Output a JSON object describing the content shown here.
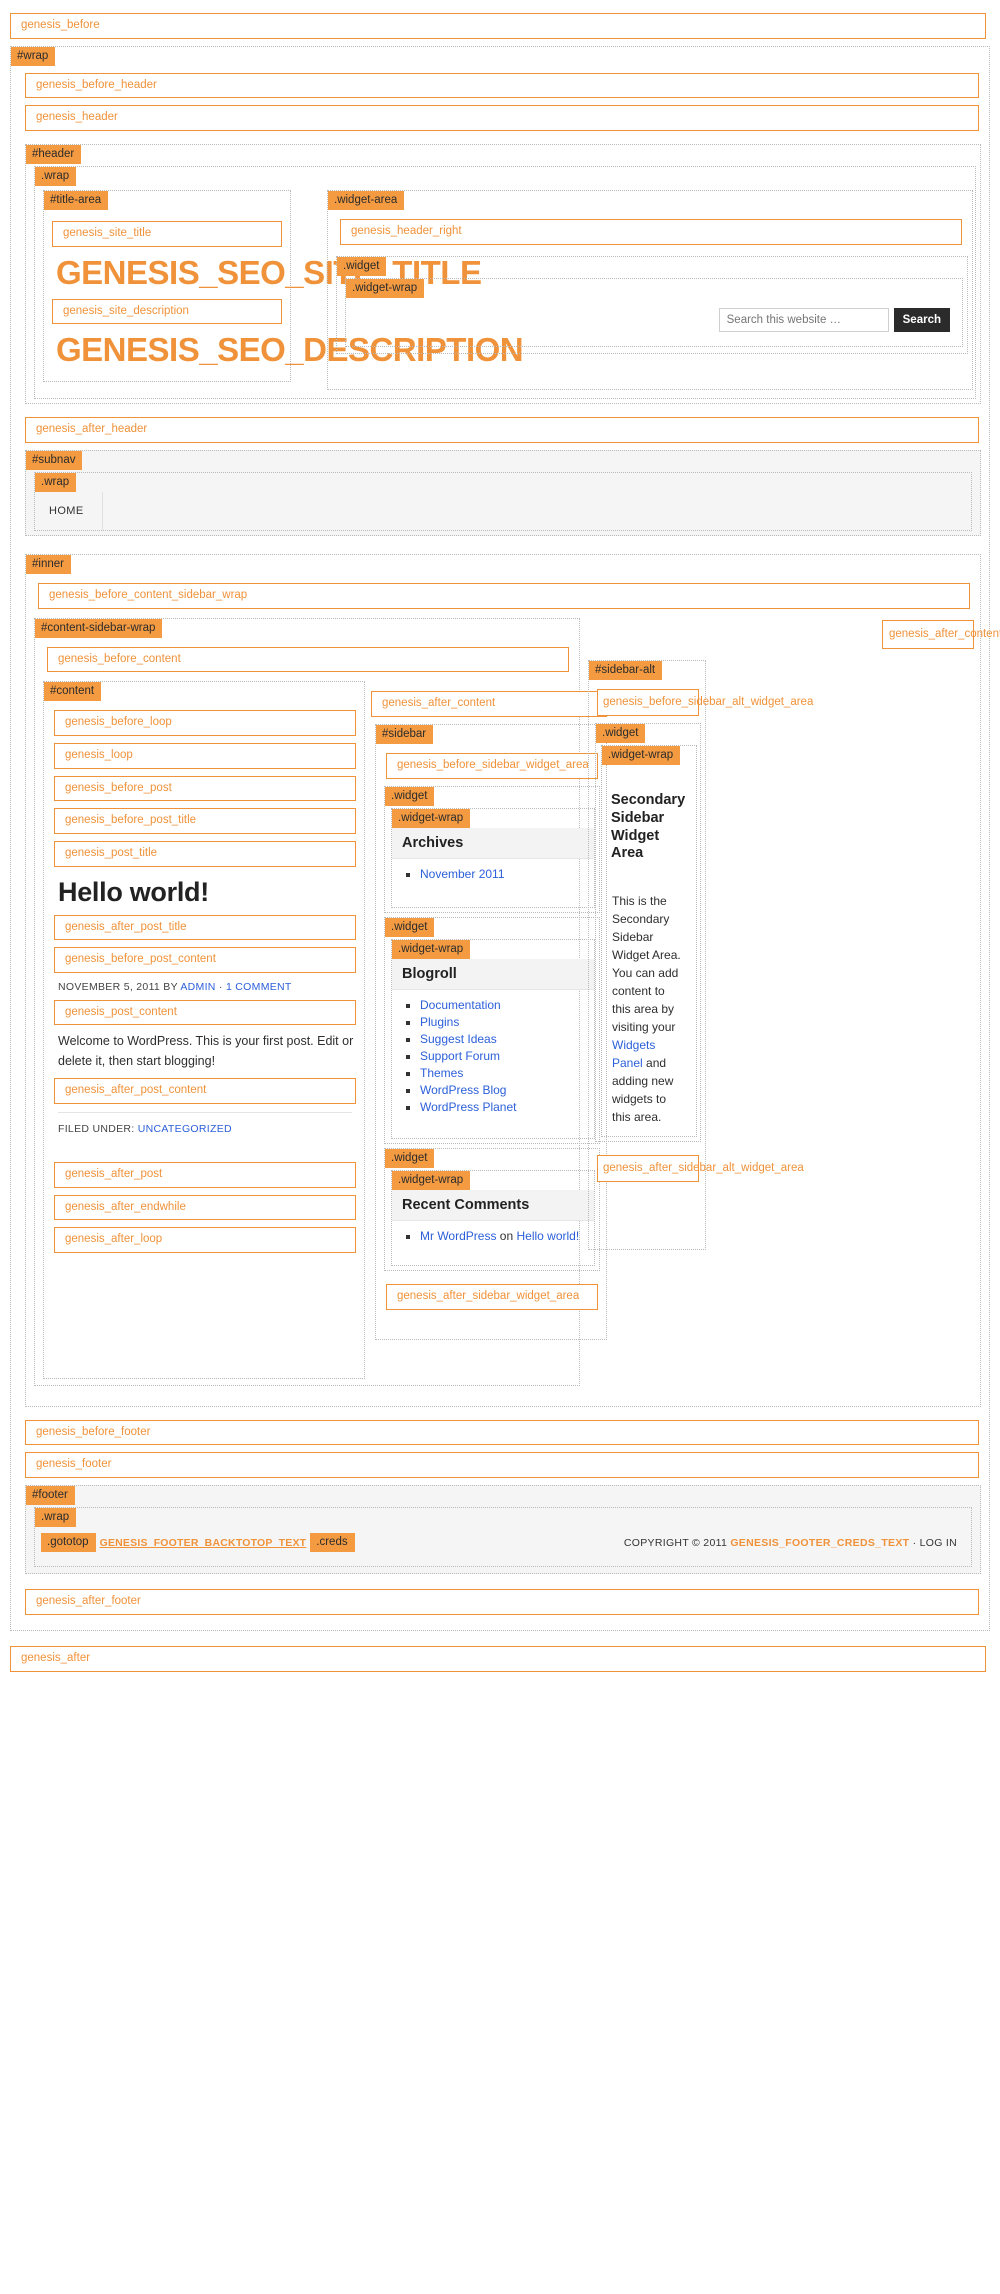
{
  "hooks": {
    "genesis_before": "genesis_before",
    "genesis_before_header": "genesis_before_header",
    "genesis_header": "genesis_header",
    "genesis_site_title": "genesis_site_title",
    "genesis_site_description": "genesis_site_description",
    "genesis_header_right": "genesis_header_right",
    "genesis_after_header": "genesis_after_header",
    "genesis_before_content_sidebar_wrap": "genesis_before_content_sidebar_wrap",
    "genesis_before_content": "genesis_before_content",
    "genesis_before_loop": "genesis_before_loop",
    "genesis_loop": "genesis_loop",
    "genesis_before_post": "genesis_before_post",
    "genesis_before_post_title": "genesis_before_post_title",
    "genesis_post_title": "genesis_post_title",
    "genesis_after_post_title": "genesis_after_post_title",
    "genesis_before_post_content": "genesis_before_post_content",
    "genesis_post_content": "genesis_post_content",
    "genesis_after_post_content": "genesis_after_post_content",
    "genesis_after_post": "genesis_after_post",
    "genesis_after_endwhile": "genesis_after_endwhile",
    "genesis_after_loop": "genesis_after_loop",
    "genesis_after_content": "genesis_after_content",
    "genesis_before_sidebar_widget_area": "genesis_before_sidebar_widget_area",
    "genesis_after_sidebar_widget_area": "genesis_after_sidebar_widget_area",
    "genesis_after_content_sidebar_wrap": "genesis_after_content_sidebar_wrap",
    "genesis_before_sidebar_alt_widget_area": "genesis_before_sidebar_alt_widget_area",
    "genesis_after_sidebar_alt_widget_area": "genesis_after_sidebar_alt_widget_area",
    "genesis_before_footer": "genesis_before_footer",
    "genesis_footer": "genesis_footer",
    "genesis_after_footer": "genesis_after_footer",
    "genesis_after": "genesis_after"
  },
  "tags": {
    "wrap": "#wrap",
    "header": "#header",
    "dot_wrap": ".wrap",
    "title_area": "#title-area",
    "widget_area": ".widget-area",
    "widget": ".widget",
    "widget_wrap": ".widget-wrap",
    "subnav": "#subnav",
    "inner": "#inner",
    "content_sidebar_wrap": "#content-sidebar-wrap",
    "content": "#content",
    "sidebar": "#sidebar",
    "sidebar_alt": "#sidebar-alt",
    "footer": "#footer",
    "gototop": ".gototop",
    "creds": ".creds"
  },
  "header": {
    "site_title": "GENESIS_SEO_SITE_TITLE",
    "site_description": "GENESIS_SEO_DESCRIPTION"
  },
  "search": {
    "placeholder": "Search this website …",
    "value": "",
    "button_label": "Search"
  },
  "subnav": {
    "items": [
      {
        "label": "HOME"
      }
    ]
  },
  "post": {
    "title": "Hello world!",
    "meta_date": "NOVEMBER 5, 2011",
    "meta_by": "BY",
    "meta_author": "ADMIN",
    "meta_separator": "·",
    "meta_comments": "1 COMMENT",
    "body": "Welcome to WordPress. This is your first post. Edit or delete it, then start blogging!",
    "filed_label": "FILED UNDER:",
    "filed_category": "UNCATEGORIZED"
  },
  "sidebar": {
    "widgets": [
      {
        "title": "Archives",
        "links": [
          "November 2011"
        ]
      },
      {
        "title": "Blogroll",
        "links": [
          "Documentation",
          "Plugins",
          "Suggest Ideas",
          "Support Forum",
          "Themes",
          "WordPress Blog",
          "WordPress Planet"
        ]
      },
      {
        "title": "Recent Comments",
        "comment_author": "Mr WordPress",
        "comment_on": "on",
        "comment_post": "Hello world!"
      }
    ]
  },
  "sidebar_alt": {
    "widget_title": "Secondary Sidebar Widget Area",
    "body_part_1": "This is the Secondary Sidebar Widget Area. You can add content to this area by visiting your",
    "body_link": "Widgets Panel",
    "body_part_2": "and adding new widgets to this area."
  },
  "footer": {
    "backtotop_text": "GENESIS_FOOTER_BACKTOTOP_TEXT",
    "copyright": "COPYRIGHT © 2011",
    "creds_text": "GENESIS_FOOTER_CREDS_TEXT",
    "separator": "·",
    "login": "LOG IN"
  },
  "colors": {
    "accent": "#f0923a",
    "tag_bg": "#f49b42",
    "link": "#2b5fd9"
  }
}
